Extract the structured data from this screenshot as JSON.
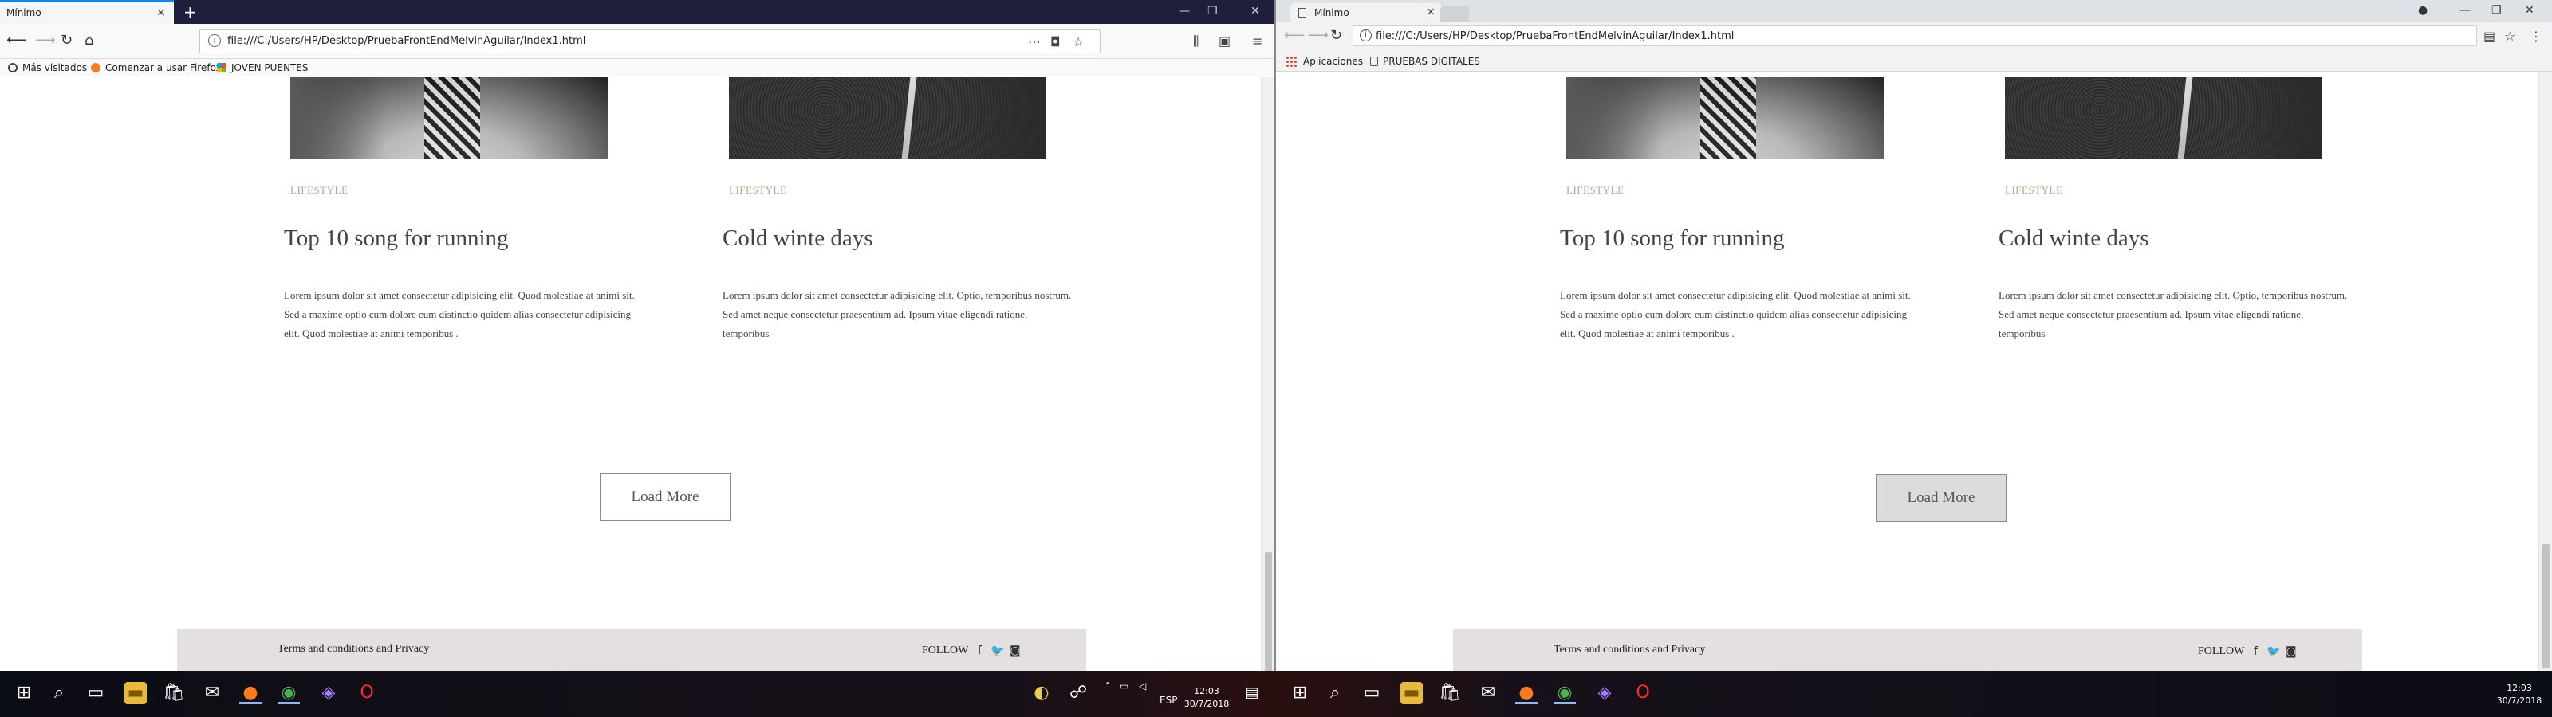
{
  "left": {
    "tab_title": "Mínimo",
    "url": "file:///C:/Users/HP/Desktop/PruebaFrontEndMelvinAguilar/Index1.html",
    "bookmarks": [
      "Más visitados",
      "Comenzar a usar Firefox",
      "JOVEN PUENTES"
    ]
  },
  "right": {
    "tab_title": "Mínimo",
    "url": "file:///C:/Users/HP/Desktop/PruebaFrontEndMelvinAguilar/Index1.html",
    "bookmarks": [
      "Aplicaciones",
      "PRUEBAS DIGITALES"
    ]
  },
  "page": {
    "cards": [
      {
        "tag": "LIFESTYLE",
        "title": "Top 10 song for running",
        "body": "Lorem ipsum dolor sit amet consectetur adipisicing elit. Quod molestiae at animi sit. Sed a maxime optio cum dolore eum distinctio quidem alias consectetur adipisicing elit. Quod molestiae at animi temporibus ."
      },
      {
        "tag": "LIFESTYLE",
        "title": "Cold winte days",
        "body": "Lorem ipsum dolor sit amet consectetur adipisicing elit. Optio, temporibus nostrum. Sed amet neque consectetur praesentium ad. Ipsum vitae eligendi ratione, temporibus"
      }
    ],
    "load_more": "Load More",
    "footer": {
      "terms": "Terms and conditions and Privacy",
      "follow": "FOLLOW",
      "social": [
        "facebook-icon",
        "twitter-icon",
        "instagram-icon"
      ]
    }
  },
  "taskbar": {
    "language": "ESP",
    "time": "12:03",
    "date": "30/7/2018"
  },
  "colors": {
    "accent_tag": "#b7a58e",
    "footer_bg": "#e3e0df",
    "firefox_tabbar": "#1e1f3d"
  }
}
